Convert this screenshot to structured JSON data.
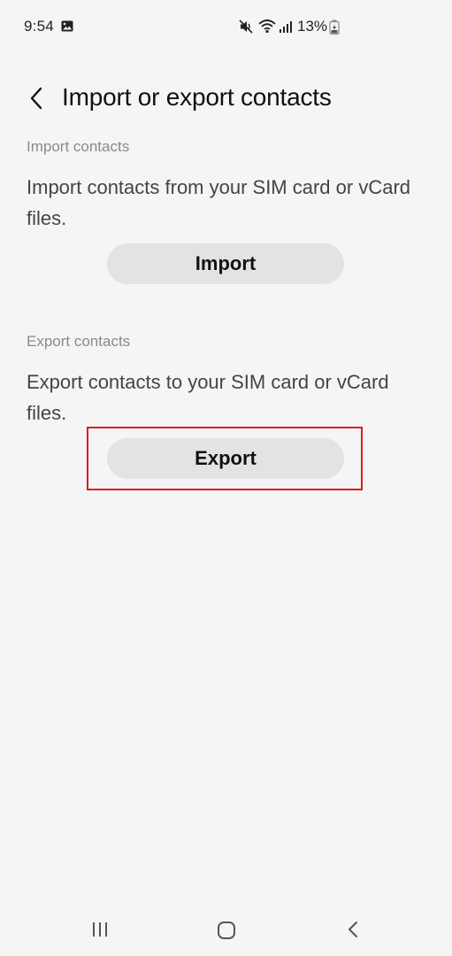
{
  "status_bar": {
    "time": "9:54",
    "battery_text": "13%",
    "icons": [
      "gallery-icon",
      "mute-icon",
      "wifi-icon",
      "signal-icon",
      "battery-icon"
    ]
  },
  "header": {
    "title": "Import or export contacts",
    "back_icon": "chevron-left-icon"
  },
  "import_section": {
    "label": "Import contacts",
    "description": "Import contacts from your SIM card or vCard files.",
    "button_label": "Import"
  },
  "export_section": {
    "label": "Export contacts",
    "description": "Export contacts to your SIM card or vCard files.",
    "button_label": "Export",
    "highlight_color": "#e0191d"
  },
  "nav_bar": {
    "icons": [
      "recents-icon",
      "home-icon",
      "back-icon"
    ]
  },
  "colors": {
    "background": "#f5f5f5",
    "button_bg": "#e3e3e3",
    "label_gray": "#8a8a8a",
    "text_dark": "#111111"
  }
}
